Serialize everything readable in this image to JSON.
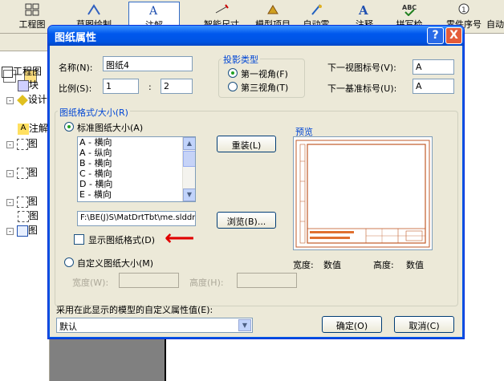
{
  "toolbar": {
    "items": [
      {
        "label": "工程图"
      },
      {
        "label": "草图绘制"
      },
      {
        "label": "注解"
      },
      {
        "label": "智能尺寸"
      },
      {
        "label": "模型项目"
      },
      {
        "label": "自动零"
      },
      {
        "label": "注释"
      },
      {
        "label": "拼写检"
      },
      {
        "label": "零件序号"
      },
      {
        "label": "自动"
      }
    ]
  },
  "tree": {
    "items": [
      {
        "label": "工程图"
      },
      {
        "label": "块"
      },
      {
        "label": "设计"
      },
      {
        "label": "注解"
      },
      {
        "label": "图"
      },
      {
        "label": "图"
      },
      {
        "label": "图"
      },
      {
        "label": "图"
      },
      {
        "label": "图"
      }
    ]
  },
  "dialog": {
    "title": "图纸属性",
    "help_symbol": "?",
    "close_symbol": "X",
    "name_label": "名称(N):",
    "name_value": "图纸4",
    "scale_label": "比例(S):",
    "scale_left": "1",
    "scale_sep": ":",
    "scale_right": "2",
    "projection": {
      "title": "投影类型",
      "first_angle": "第一视角(F)",
      "third_angle": "第三视角(T)",
      "selected": "first_angle"
    },
    "next_view_label": "下一视图标号(V):",
    "next_view_value": "A",
    "next_datum_label": "下一基准标号(U):",
    "next_datum_value": "A",
    "format_group_title": "图纸格式/大小(R)",
    "standard_size_label": "标准图纸大小(A)",
    "sizes": [
      "A - 横向",
      "A - 纵向",
      "B - 横向",
      "C - 横向",
      "D - 横向",
      "E - 横向"
    ],
    "reload_button": "重装(L)",
    "format_path": "F:\\BE(J)S\\MatDrtTbt\\me.slddrt",
    "browse_button": "浏览(B)...",
    "show_format_label": "显示图纸格式(D)",
    "show_format_checked": false,
    "custom_size_label": "自定义图纸大小(M)",
    "width_label": "宽度(W):",
    "width_value": "",
    "height_label": "高度(H):",
    "height_value": "",
    "preview_title": "预览",
    "preview_width_label": "宽度:",
    "preview_width_value": "数值",
    "preview_height_label": "高度:",
    "preview_height_value": "数值",
    "custom_props_label": "采用在此显示的模型的自定义属性值(E):",
    "custom_props_value": "默认",
    "ok_button": "确定(O)",
    "cancel_button": "取消(C)"
  },
  "colors": {
    "title_gradient": "#0054e3",
    "group_title": "#0046d5",
    "annotation_arrow": "#e00000",
    "preview_border": "#c05a28"
  },
  "annotation": {
    "arrow": "⟵"
  }
}
